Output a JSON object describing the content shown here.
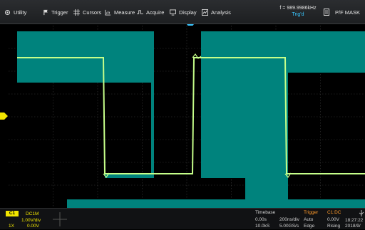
{
  "menu": {
    "utility": "Utility",
    "trigger": "Trigger",
    "cursors": "Cursors",
    "measure": "Measure",
    "acquire": "Acquire",
    "display": "Display",
    "analysis": "Analysis",
    "pf_mask": "P/F MASK"
  },
  "status": {
    "frequency": "f = 989.9986kHz",
    "trigger_state": "Trig'd"
  },
  "channel": {
    "label": "C1",
    "coupling": "DC1M",
    "volts_div": "1.00V/div",
    "probe": "1X",
    "offset": "0.00V",
    "color": "#f2e600"
  },
  "timebase": {
    "title": "Timebase",
    "delay": "0.00s",
    "time_div": "200ns/div",
    "memory": "10.0kS",
    "sample_rate": "5.00GS/s"
  },
  "trigger": {
    "title": "Trigger",
    "source": "C1:DC",
    "mode": "Auto",
    "level": "0.00V",
    "type": "Edge",
    "slope": "Rising"
  },
  "clock": {
    "time": "18:27:22",
    "date": "2018/9/"
  },
  "colors": {
    "waveform_fill": "#00837d",
    "trace": "#c6ff8a",
    "accent": "#39c6ff",
    "trigger_label": "#ff9a2a"
  },
  "icons": [
    "gear-icon",
    "flag-icon",
    "grid-icon",
    "ruler-icon",
    "acquire-icon",
    "monitor-icon",
    "analysis-icon",
    "document-icon",
    "usb-icon"
  ]
}
